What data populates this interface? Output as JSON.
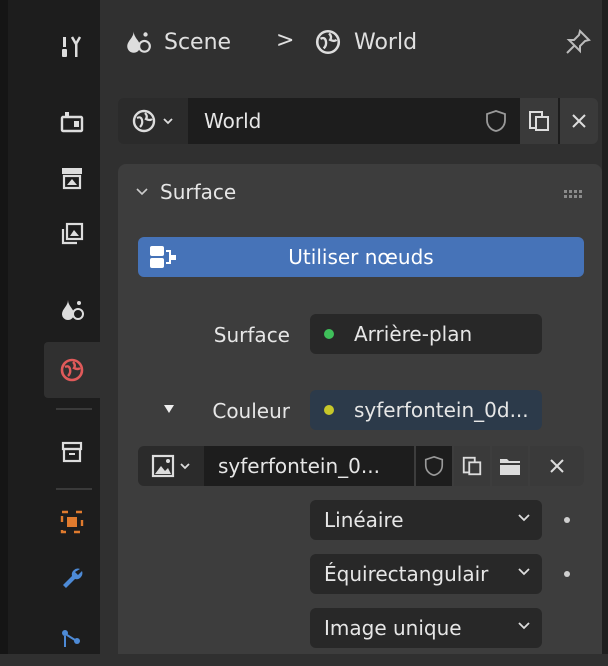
{
  "header": {
    "scene_label": "Scene",
    "separator": ">",
    "world_label": "World",
    "icons": [
      "scene-icon",
      "world-icon",
      "pin-icon"
    ]
  },
  "datablock": {
    "name": "World",
    "type_icon": "world-icon"
  },
  "panel": {
    "title": "Surface",
    "use_nodes_label": "Utiliser nœuds",
    "surface_label": "Surface",
    "surface_value": "Arrière-plan",
    "color_label": "Couleur",
    "color_value": "syferfontein_0d...",
    "image_name": "syferfontein_0...",
    "interpolation": "Linéaire",
    "projection": "Équirectangulair",
    "source": "Image unique"
  },
  "colors": {
    "accent_blue": "#4673b8",
    "shader_green": "#3fbf5a",
    "texture_yellow": "#c7c72a",
    "world_red": "#e05a5a"
  }
}
